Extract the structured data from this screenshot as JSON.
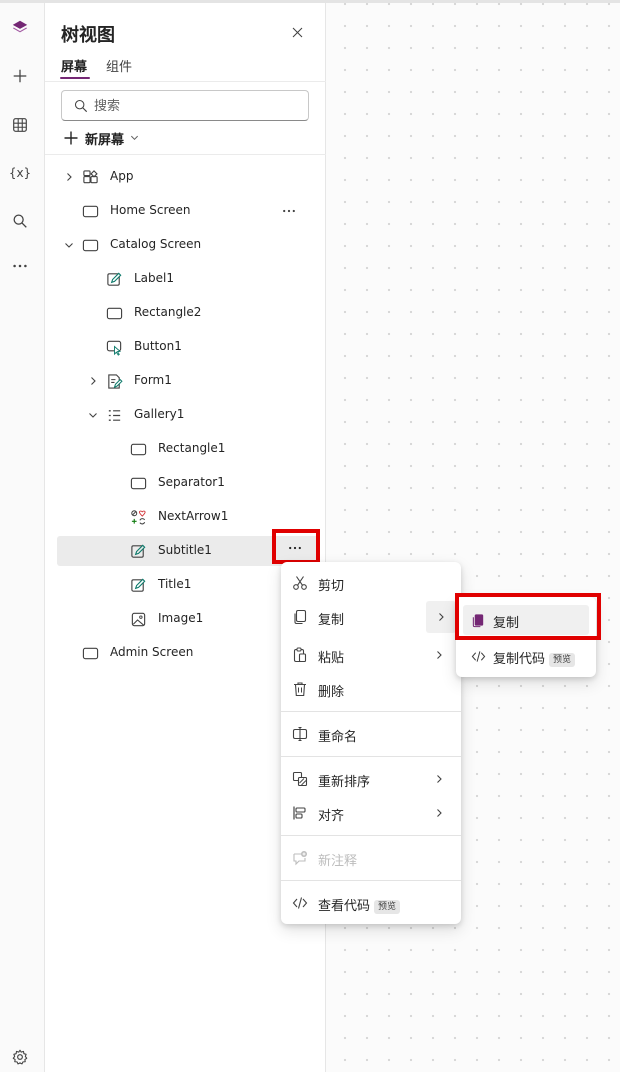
{
  "panel": {
    "title": "树视图",
    "tabs": [
      {
        "label": "屏幕",
        "active": true
      },
      {
        "label": "组件",
        "active": false
      }
    ],
    "search_placeholder": "搜索",
    "new_screen_label": "新屏幕"
  },
  "tree": [
    {
      "label": "App",
      "icon": "app-icon"
    },
    {
      "label": "Home Screen",
      "icon": "screen-icon"
    },
    {
      "label": "Catalog Screen",
      "icon": "screen-icon"
    },
    {
      "label": "Label1",
      "icon": "label-icon"
    },
    {
      "label": "Rectangle2",
      "icon": "rectangle-icon"
    },
    {
      "label": "Button1",
      "icon": "button-icon"
    },
    {
      "label": "Form1",
      "icon": "form-icon"
    },
    {
      "label": "Gallery1",
      "icon": "gallery-icon"
    },
    {
      "label": "Rectangle1",
      "icon": "rectangle-icon"
    },
    {
      "label": "Separator1",
      "icon": "rectangle-icon"
    },
    {
      "label": "NextArrow1",
      "icon": "icon-control-icon"
    },
    {
      "label": "Subtitle1",
      "icon": "label-icon",
      "selected": true
    },
    {
      "label": "Title1",
      "icon": "label-icon"
    },
    {
      "label": "Image1",
      "icon": "image-icon"
    },
    {
      "label": "Admin Screen",
      "icon": "screen-icon"
    }
  ],
  "rail": {
    "variables_label": "{x}"
  },
  "context_menu": {
    "items": [
      {
        "label": "剪切",
        "icon": "cut-icon"
      },
      {
        "label": "复制",
        "icon": "copy-icon",
        "has_submenu": true
      },
      {
        "label": "粘贴",
        "icon": "paste-icon",
        "has_submenu": true
      },
      {
        "label": "删除",
        "icon": "delete-icon"
      },
      {
        "label": "重命名",
        "icon": "rename-icon"
      },
      {
        "label": "重新排序",
        "icon": "reorder-icon",
        "has_submenu": true
      },
      {
        "label": "对齐",
        "icon": "align-icon",
        "has_submenu": true
      },
      {
        "label": "新注释",
        "icon": "comment-add-icon",
        "disabled": true
      },
      {
        "label": "查看代码",
        "icon": "code-icon",
        "badge": "预览"
      }
    ]
  },
  "submenu": {
    "items": [
      {
        "label": "复制",
        "icon": "copy-filled-icon"
      },
      {
        "label": "复制代码",
        "icon": "code-icon",
        "badge": "预览"
      }
    ]
  },
  "colors": {
    "accent": "#742774",
    "highlight_box": "#e00000",
    "selected_row": "#ebebeb"
  }
}
